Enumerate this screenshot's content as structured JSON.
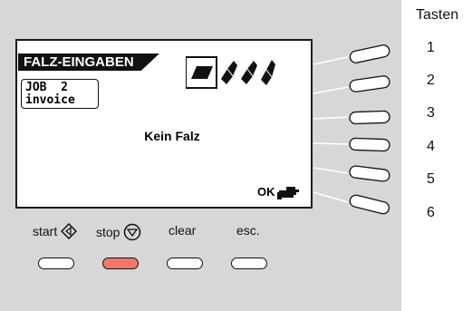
{
  "display": {
    "title": "FALZ-EINGABEN",
    "job_line": "JOB  2",
    "job_name": "invoice",
    "status": "Kein Falz",
    "ok_label": "OK"
  },
  "bottom_buttons": {
    "start": "start",
    "stop": "stop",
    "clear": "clear",
    "esc": "esc."
  },
  "side_keys": {
    "title": "Tasten",
    "numbers": [
      "1",
      "2",
      "3",
      "4",
      "5",
      "6"
    ]
  },
  "colors": {
    "panel": "#d7d7d7",
    "stop_button": "#ef7a6a",
    "text": "#111111"
  },
  "icons": [
    "start-diamond-icon",
    "stop-circle-icon",
    "pointing-hand-icon",
    "fold-flat-icon",
    "fold-single-icon",
    "fold-double-icon",
    "fold-z-icon"
  ]
}
